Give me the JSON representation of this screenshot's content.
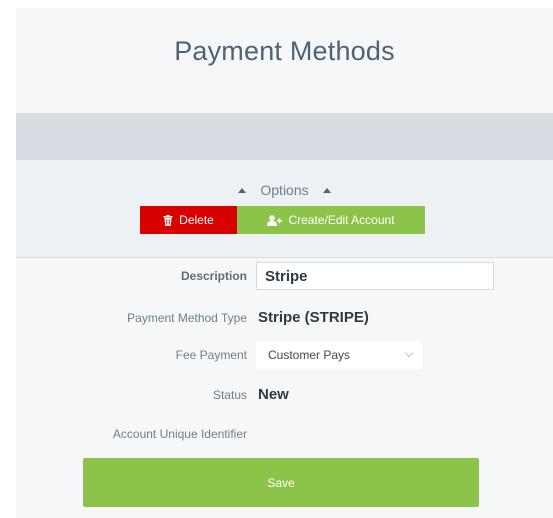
{
  "header": {
    "title": "Payment Methods"
  },
  "options": {
    "label": "Options",
    "delete_label": "Delete",
    "create_edit_label": "Create/Edit Account"
  },
  "form": {
    "description": {
      "label": "Description",
      "value": "Stripe"
    },
    "payment_method_type": {
      "label": "Payment Method Type",
      "value": "Stripe (STRIPE)"
    },
    "fee_payment": {
      "label": "Fee Payment",
      "selected": "Customer Pays"
    },
    "status": {
      "label": "Status",
      "value": "New"
    },
    "account_unique_identifier": {
      "label": "Account Unique Identifier",
      "value": ""
    },
    "save_label": "Save"
  },
  "icons": {
    "delete": "trash-icon",
    "create_edit": "add-user-icon",
    "options_caret": "caret-up-icon",
    "select_chevron": "chevron-down-icon"
  },
  "colors": {
    "delete_button": "#d90000",
    "accent_green": "#8cc44a",
    "title_text": "#4d6478",
    "band_grey": "#d8dde3"
  }
}
